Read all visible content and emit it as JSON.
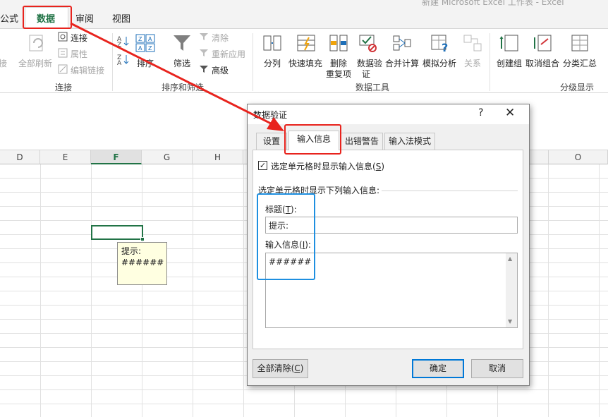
{
  "window": {
    "title": "新建 Microsoft Excel 工作表 - Excel"
  },
  "tabs": [
    {
      "label": "公式"
    },
    {
      "label": "数据"
    },
    {
      "label": "审阅"
    },
    {
      "label": "视图"
    }
  ],
  "ribbon": {
    "connections": {
      "partial_left": "接",
      "refresh_all": "全部刷新",
      "connect": "连接",
      "properties": "属性",
      "edit_links": "编辑链接",
      "group_name": "连接"
    },
    "sort_filter": {
      "sort": "排序",
      "filter": "筛选",
      "clear": "清除",
      "reapply": "重新应用",
      "advanced": "高级",
      "group_name": "排序和筛选"
    },
    "data_tools": {
      "split": "分列",
      "flash_fill": "快速填充",
      "remove_dup_line1": "删除",
      "remove_dup_line2": "重复项",
      "validation_line1": "数据验",
      "validation_line2": "证",
      "consolidate": "合并计算",
      "what_if": "模拟分析",
      "relations": "关系",
      "group_name": "数据工具"
    },
    "outline": {
      "group": "创建组",
      "ungroup": "取消组合",
      "subtotal": "分类汇总",
      "group_name": "分级显示"
    }
  },
  "columns": [
    "D",
    "E",
    "F",
    "G",
    "H",
    "O"
  ],
  "selected_column": "F",
  "cell_tooltip": {
    "title": "提示:",
    "message": "######"
  },
  "dialog": {
    "title": "数据验证",
    "help": "?",
    "close": "✕",
    "tabs": [
      "设置",
      "输入信息",
      "出错警告",
      "输入法模式"
    ],
    "active_tab": "输入信息",
    "show_input_checkbox": {
      "checked": true,
      "mark": "✓",
      "label": "选定单元格时显示输入信息",
      "shortcut": "S"
    },
    "section_label": "选定单元格时显示下列输入信息:",
    "title_label": "标题",
    "title_shortcut": "T",
    "title_value": "提示:",
    "message_label": "输入信息",
    "message_shortcut": "I",
    "message_value": "######",
    "clear_all_label": "全部清除",
    "clear_all_shortcut": "C",
    "ok_label": "确定",
    "cancel_label": "取消"
  },
  "annotations": {
    "red_color": "#e8231d",
    "blue_color": "#1e8fe0"
  }
}
